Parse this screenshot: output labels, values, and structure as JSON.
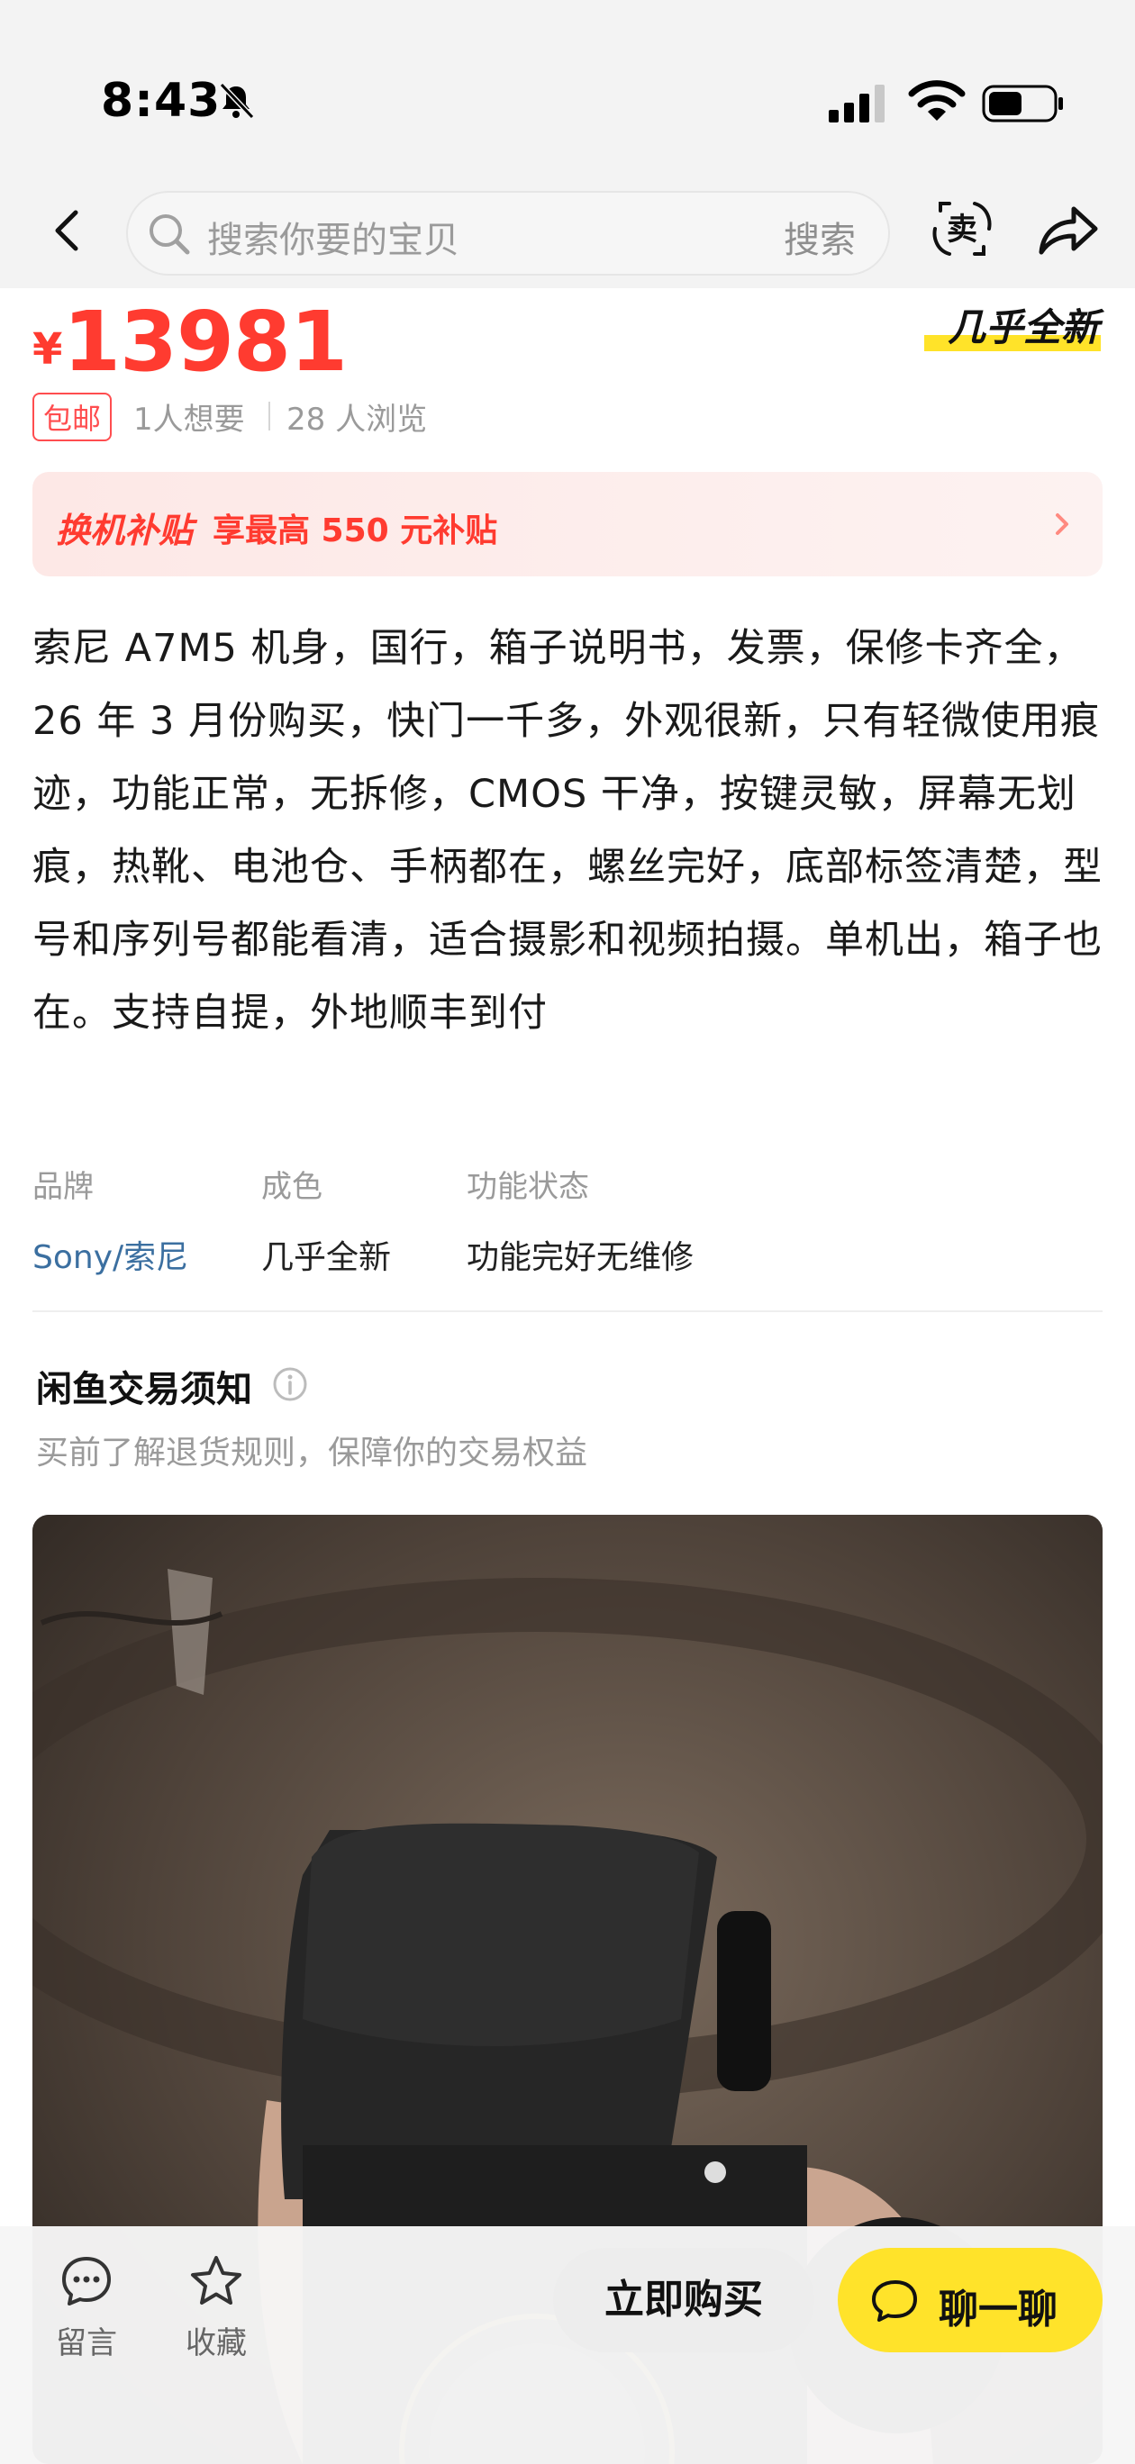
{
  "status_bar": {
    "time": "8:43"
  },
  "header": {
    "search_placeholder": "搜索你要的宝贝",
    "search_button": "搜索",
    "sell_icon": "卖"
  },
  "product": {
    "currency": "¥",
    "price": "13981",
    "condition": "几乎全新",
    "free_shipping_badge": "包邮",
    "wants": "1人想要",
    "views": "28 人浏览"
  },
  "subsidy": {
    "tag": "换机补贴",
    "text": "享最高 550 元补贴"
  },
  "description": "索尼 A7M5 机身，国行，箱子说明书，发票，保修卡齐全，26 年 3 月份购买，快门一千多，外观很新，只有轻微使用痕迹，功能正常，无拆修，CMOS 干净，按键灵敏，屏幕无划痕，热靴、电池仓、手柄都在，螺丝完好，底部标签清楚，型号和序列号都能看清，适合摄影和视频拍摄。单机出，箱子也在。支持自提，外地顺丰到付",
  "attributes": [
    {
      "label": "品牌",
      "value": "Sony/索尼"
    },
    {
      "label": "成色",
      "value": "几乎全新"
    },
    {
      "label": "功能状态",
      "value": "功能完好无维修"
    }
  ],
  "notice": {
    "title": "闲鱼交易须知",
    "subtitle": "买前了解退货规则，保障你的交易权益"
  },
  "bottom_bar": {
    "comment": "留言",
    "favorite": "收藏",
    "buy_now": "立即购买",
    "chat": "聊一聊"
  },
  "colors": {
    "price_red": "#ff3b30",
    "accent_yellow": "#ffe32a",
    "link_blue": "#3b6fa0"
  }
}
